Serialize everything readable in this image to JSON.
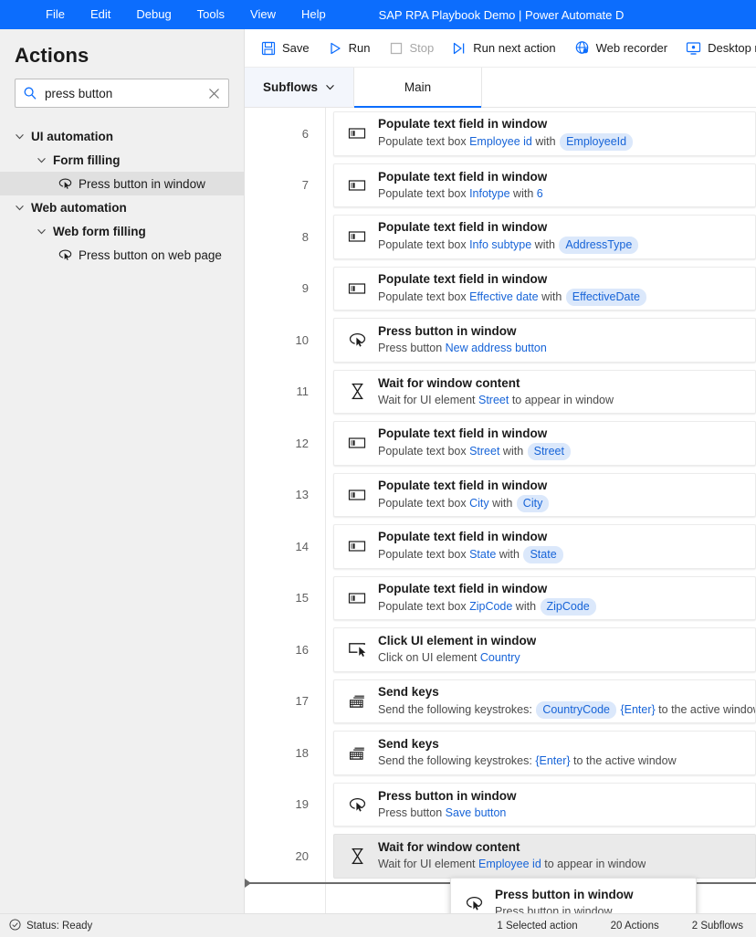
{
  "window": {
    "title": "SAP RPA Playbook Demo | Power Automate D",
    "accent": "#0c6dfd",
    "menu": [
      "File",
      "Edit",
      "Debug",
      "Tools",
      "View",
      "Help"
    ]
  },
  "sidebar": {
    "heading": "Actions",
    "search": {
      "value": "press button",
      "placeholder": "Search actions",
      "icon": "search-icon",
      "clear_icon": "close-icon"
    },
    "tree": [
      {
        "label": "UI automation",
        "level": 0,
        "type": "group",
        "expanded": true,
        "icon": "chevron-down-icon"
      },
      {
        "label": "Form filling",
        "level": 1,
        "type": "group",
        "expanded": true,
        "icon": "chevron-down-icon"
      },
      {
        "label": "Press button in window",
        "level": 2,
        "type": "action",
        "selected": true,
        "icon": "press-button-icon"
      },
      {
        "label": "Web automation",
        "level": 0,
        "type": "group",
        "expanded": true,
        "icon": "chevron-down-icon"
      },
      {
        "label": "Web form filling",
        "level": 1,
        "type": "group",
        "expanded": true,
        "icon": "chevron-down-icon"
      },
      {
        "label": "Press button on web page",
        "level": 2,
        "type": "action",
        "selected": false,
        "icon": "press-button-icon"
      }
    ]
  },
  "toolbar": {
    "buttons": [
      {
        "label": "Save",
        "icon": "save-icon",
        "disabled": false
      },
      {
        "label": "Run",
        "icon": "play-icon",
        "disabled": false
      },
      {
        "label": "Stop",
        "icon": "stop-icon",
        "disabled": true
      },
      {
        "label": "Run next action",
        "icon": "step-over-icon",
        "disabled": false
      },
      {
        "label": "Web recorder",
        "icon": "globe-icon",
        "disabled": false
      },
      {
        "label": "Desktop recorder",
        "icon": "monitor-icon",
        "disabled": false
      }
    ]
  },
  "tabs": [
    {
      "label": "Subflows",
      "active": false,
      "has_chevron": true,
      "icon": "chevron-down-icon"
    },
    {
      "label": "Main",
      "active": true,
      "has_chevron": false
    }
  ],
  "workspace": {
    "actions": [
      {
        "num": "6",
        "icon": "text-field-icon",
        "title": "Populate text field in window",
        "parts": [
          {
            "t": "plain",
            "v": "Populate text box "
          },
          {
            "t": "link",
            "v": "Employee id"
          },
          {
            "t": "plain",
            "v": " with "
          },
          {
            "t": "pill",
            "v": "EmployeeId"
          }
        ]
      },
      {
        "num": "7",
        "icon": "text-field-icon",
        "title": "Populate text field in window",
        "parts": [
          {
            "t": "plain",
            "v": "Populate text box "
          },
          {
            "t": "link",
            "v": "Infotype"
          },
          {
            "t": "plain",
            "v": " with "
          },
          {
            "t": "link",
            "v": "6"
          }
        ]
      },
      {
        "num": "8",
        "icon": "text-field-icon",
        "title": "Populate text field in window",
        "parts": [
          {
            "t": "plain",
            "v": "Populate text box "
          },
          {
            "t": "link",
            "v": "Info subtype"
          },
          {
            "t": "plain",
            "v": " with "
          },
          {
            "t": "pill",
            "v": "AddressType"
          }
        ]
      },
      {
        "num": "9",
        "icon": "text-field-icon",
        "title": "Populate text field in window",
        "parts": [
          {
            "t": "plain",
            "v": "Populate text box "
          },
          {
            "t": "link",
            "v": "Effective date"
          },
          {
            "t": "plain",
            "v": " with "
          },
          {
            "t": "pill",
            "v": "EffectiveDate"
          }
        ]
      },
      {
        "num": "10",
        "icon": "press-button-icon",
        "title": "Press button in window",
        "parts": [
          {
            "t": "plain",
            "v": "Press button "
          },
          {
            "t": "link",
            "v": "New address button"
          }
        ]
      },
      {
        "num": "11",
        "icon": "hourglass-icon",
        "title": "Wait for window content",
        "parts": [
          {
            "t": "plain",
            "v": "Wait for UI element "
          },
          {
            "t": "link",
            "v": "Street"
          },
          {
            "t": "plain",
            "v": " to appear in window"
          }
        ]
      },
      {
        "num": "12",
        "icon": "text-field-icon",
        "title": "Populate text field in window",
        "parts": [
          {
            "t": "plain",
            "v": "Populate text box "
          },
          {
            "t": "link",
            "v": "Street"
          },
          {
            "t": "plain",
            "v": " with "
          },
          {
            "t": "pill",
            "v": "Street"
          }
        ]
      },
      {
        "num": "13",
        "icon": "text-field-icon",
        "title": "Populate text field in window",
        "parts": [
          {
            "t": "plain",
            "v": "Populate text box "
          },
          {
            "t": "link",
            "v": "City"
          },
          {
            "t": "plain",
            "v": " with "
          },
          {
            "t": "pill",
            "v": "City"
          }
        ]
      },
      {
        "num": "14",
        "icon": "text-field-icon",
        "title": "Populate text field in window",
        "parts": [
          {
            "t": "plain",
            "v": "Populate text box "
          },
          {
            "t": "link",
            "v": "State"
          },
          {
            "t": "plain",
            "v": " with "
          },
          {
            "t": "pill",
            "v": "State"
          }
        ]
      },
      {
        "num": "15",
        "icon": "text-field-icon",
        "title": "Populate text field in window",
        "parts": [
          {
            "t": "plain",
            "v": "Populate text box "
          },
          {
            "t": "link",
            "v": "ZipCode"
          },
          {
            "t": "plain",
            "v": " with "
          },
          {
            "t": "pill",
            "v": "ZipCode"
          }
        ]
      },
      {
        "num": "16",
        "icon": "click-element-icon",
        "title": "Click UI element in window",
        "parts": [
          {
            "t": "plain",
            "v": "Click on UI element "
          },
          {
            "t": "link",
            "v": "Country"
          }
        ]
      },
      {
        "num": "17",
        "icon": "keyboard-icon",
        "title": "Send keys",
        "parts": [
          {
            "t": "plain",
            "v": "Send the following keystrokes: "
          },
          {
            "t": "pill",
            "v": "CountryCode"
          },
          {
            "t": "plain",
            "v": " "
          },
          {
            "t": "link",
            "v": "{Enter}"
          },
          {
            "t": "plain",
            "v": " to the active window"
          }
        ]
      },
      {
        "num": "18",
        "icon": "keyboard-icon",
        "title": "Send keys",
        "parts": [
          {
            "t": "plain",
            "v": "Send the following keystrokes: "
          },
          {
            "t": "link",
            "v": "{Enter}"
          },
          {
            "t": "plain",
            "v": " to the active window"
          }
        ]
      },
      {
        "num": "19",
        "icon": "press-button-icon",
        "title": "Press button in window",
        "parts": [
          {
            "t": "plain",
            "v": "Press button "
          },
          {
            "t": "link",
            "v": "Save button"
          }
        ]
      },
      {
        "num": "20",
        "icon": "hourglass-icon",
        "title": "Wait for window content",
        "selected": true,
        "parts": [
          {
            "t": "plain",
            "v": "Wait for UI element "
          },
          {
            "t": "link",
            "v": "Employee id"
          },
          {
            "t": "plain",
            "v": " to appear in window"
          }
        ]
      }
    ],
    "drag_ghost": {
      "title": "Press button in window",
      "subtitle": "Press button in window",
      "icon": "press-button-icon"
    }
  },
  "statusbar": {
    "status": "Status: Ready",
    "status_icon": "check-circle-icon",
    "selected_actions": "1 Selected action",
    "actions_count": "20 Actions",
    "subflows_count": "2 Subflows"
  }
}
